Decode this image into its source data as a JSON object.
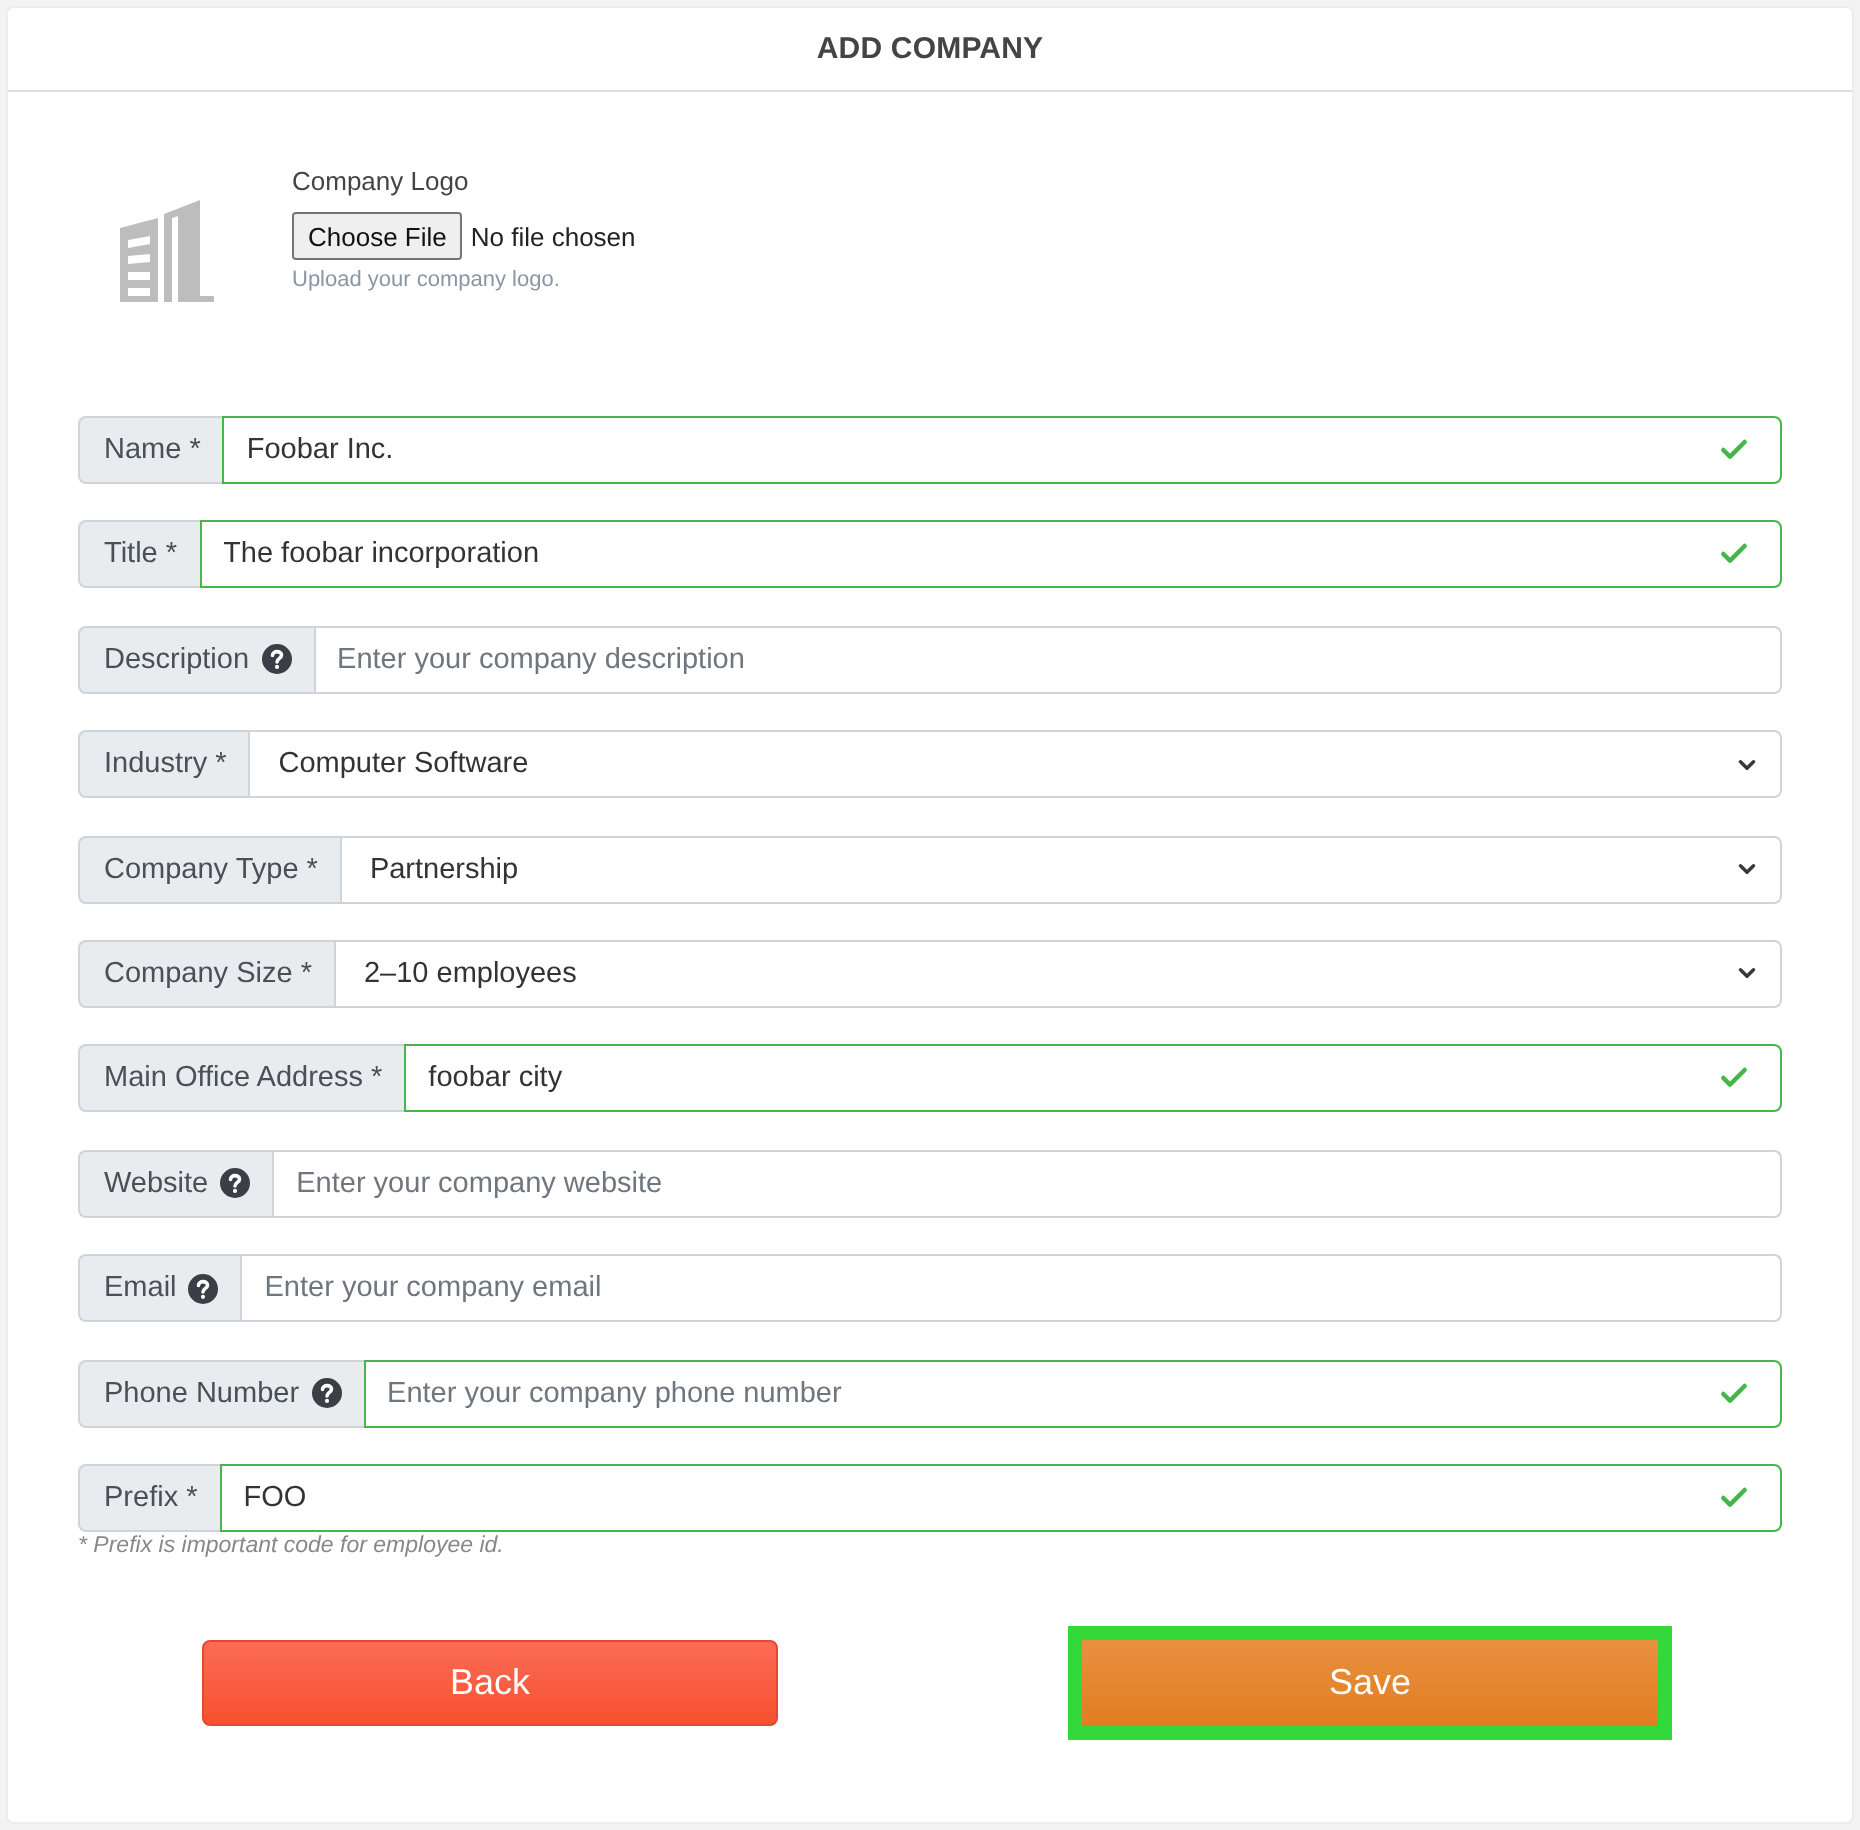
{
  "header": {
    "title": "ADD COMPANY"
  },
  "logo_upload": {
    "label": "Company Logo",
    "button": "Choose File",
    "status": "No file chosen",
    "hint": "Upload your company logo."
  },
  "fields": [
    {
      "kind": "input",
      "label": "Name *",
      "help": false,
      "value": "Foobar Inc.",
      "valid": true
    },
    {
      "kind": "input",
      "label": "Title *",
      "help": false,
      "value": "The foobar incorporation",
      "valid": true
    },
    {
      "kind": "input",
      "label": "Description",
      "help": true,
      "placeholder": "Enter your company description",
      "valid": false
    },
    {
      "kind": "select",
      "label": "Industry *",
      "help": false,
      "value": "Computer Software",
      "valid": false
    },
    {
      "kind": "select",
      "label": "Company Type *",
      "help": false,
      "value": "Partnership",
      "valid": false
    },
    {
      "kind": "select",
      "label": "Company Size *",
      "help": false,
      "value": "2–10 employees",
      "valid": false
    },
    {
      "kind": "input",
      "label": "Main Office Address *",
      "help": false,
      "value": "foobar city",
      "valid": true
    },
    {
      "kind": "input",
      "label": "Website",
      "help": true,
      "placeholder": "Enter your company website",
      "valid": false
    },
    {
      "kind": "input",
      "label": "Email",
      "help": true,
      "placeholder": "Enter your company email",
      "valid": false
    },
    {
      "kind": "input",
      "label": "Phone Number",
      "help": true,
      "placeholder": "Enter your company phone number",
      "valid": true
    },
    {
      "kind": "input",
      "label": "Prefix *",
      "help": false,
      "value": "FOO",
      "valid": true
    }
  ],
  "prefix_note": "* Prefix is important code for employee id.",
  "buttons": [
    {
      "kind": "back",
      "label": "Back",
      "focused": false
    },
    {
      "kind": "save",
      "label": "Save",
      "focused": true
    }
  ]
}
